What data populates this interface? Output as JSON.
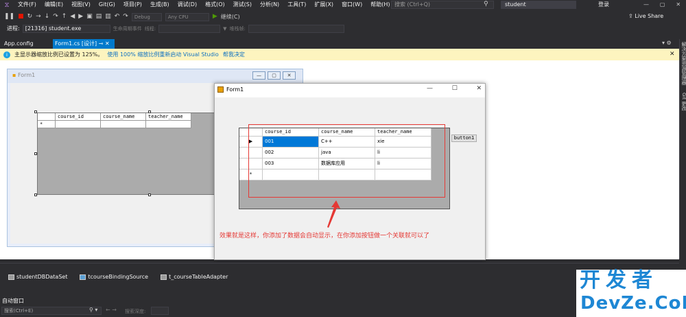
{
  "menubar": {
    "items": [
      "文件(F)",
      "编辑(E)",
      "视图(V)",
      "Git(G)",
      "项目(P)",
      "生成(B)",
      "调试(D)",
      "格式(O)",
      "测试(S)",
      "分析(N)",
      "工具(T)",
      "扩展(X)",
      "窗口(W)",
      "帮助(H)"
    ],
    "search_placeholder": "搜索 (Ctrl+Q)",
    "project_name": "student",
    "login": "登录"
  },
  "toolbar": {
    "config": "Debug",
    "platform": "Any CPU",
    "start_label": "继续(C)",
    "live_share": "Live Share"
  },
  "toolbar2": {
    "process_label": "进程:",
    "process_value": "[21316] student.exe",
    "lifecycle_label": "生命周期事件",
    "thread_label": "线程:",
    "stack_label": "堆栈帧:"
  },
  "tabs": {
    "tab1": "App.config",
    "tab2": "Form1.cs [设计]"
  },
  "infobar": {
    "message": "主显示器缩放比例已设置为 125%。",
    "link1": "使用 100% 缩放比例重新启动 Visual Studio",
    "link2": "帮我决定"
  },
  "sidepanel": {
    "label1": "解决方案资源管理器",
    "label2": "Git 更改"
  },
  "designer_form": {
    "title": "Form1",
    "columns": [
      "course_id",
      "course_name",
      "teacher_name"
    ],
    "new_row_marker": "*"
  },
  "runtime_form": {
    "title": "Form1",
    "columns": [
      "course_id",
      "course_name",
      "teacher_name"
    ],
    "rows": [
      {
        "marker": "▶",
        "course_id": "001",
        "course_name": "C++",
        "teacher_name": "xie"
      },
      {
        "marker": "",
        "course_id": "002",
        "course_name": "java",
        "teacher_name": "li"
      },
      {
        "marker": "",
        "course_id": "003",
        "course_name": "数据库应用",
        "teacher_name": "li"
      }
    ],
    "new_row_marker": "*",
    "button_label": "button1"
  },
  "annotation": "效果就是这样，你添加了数据会自动显示，在你添加按钮做一个关联就可以了",
  "component_tray": [
    "studentDBDataSet",
    "tcourseBindingSource",
    "t_courseTableAdapter"
  ],
  "autos": {
    "title": "自动窗口",
    "search_placeholder": "搜索(Ctrl+E)",
    "depth_label": "搜索深度:"
  },
  "watermark": {
    "line1": "开发者",
    "line2": "DevZe.CoM"
  },
  "colors": {
    "accent": "#007acc",
    "annotation": "#e53935",
    "selection": "#0078d7",
    "watermark": "#1e87d4"
  }
}
